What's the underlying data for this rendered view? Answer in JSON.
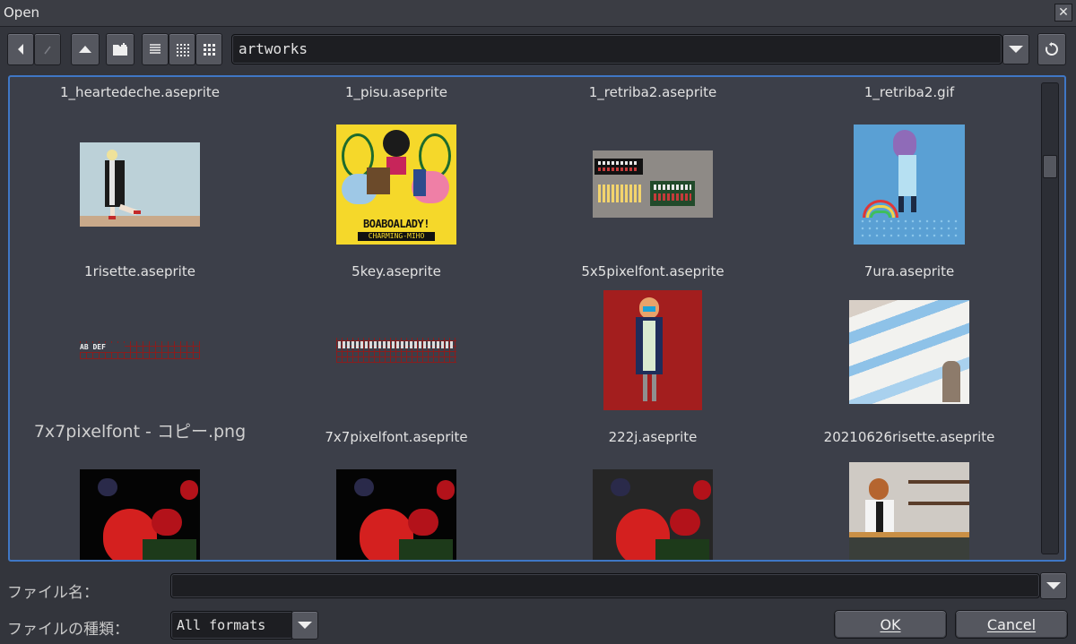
{
  "window": {
    "title": "Open"
  },
  "toolbar": {
    "path": "artworks"
  },
  "files": [
    {
      "name": "1_heartedeche.aseprite"
    },
    {
      "name": "1_pisu.aseprite"
    },
    {
      "name": "1_retriba2.aseprite"
    },
    {
      "name": "1_retriba2.gif"
    },
    {
      "name": "1risette.aseprite"
    },
    {
      "name": "5key.aseprite"
    },
    {
      "name": "5x5pixelfont.aseprite"
    },
    {
      "name": "7ura.aseprite"
    },
    {
      "name": "7x7pixelfont - コピー.png"
    },
    {
      "name": "7x7pixelfont.aseprite"
    },
    {
      "name": "222j.aseprite"
    },
    {
      "name": "20210626risette.aseprite"
    }
  ],
  "thumb_text": {
    "boaboa_title": "BOABOALADY!",
    "boaboa_sub": "CHARMING-MIHO",
    "font_sample": "AB DEF"
  },
  "footer": {
    "filename_label": "ファイル名：",
    "filename_value": "",
    "filetype_label": "ファイルの種類：",
    "filetype_value": "All formats",
    "ok_label": "OK",
    "cancel_label": "Cancel"
  },
  "colors": {
    "accent": "#3f77c5",
    "panel_bg": "#3c3f49"
  }
}
